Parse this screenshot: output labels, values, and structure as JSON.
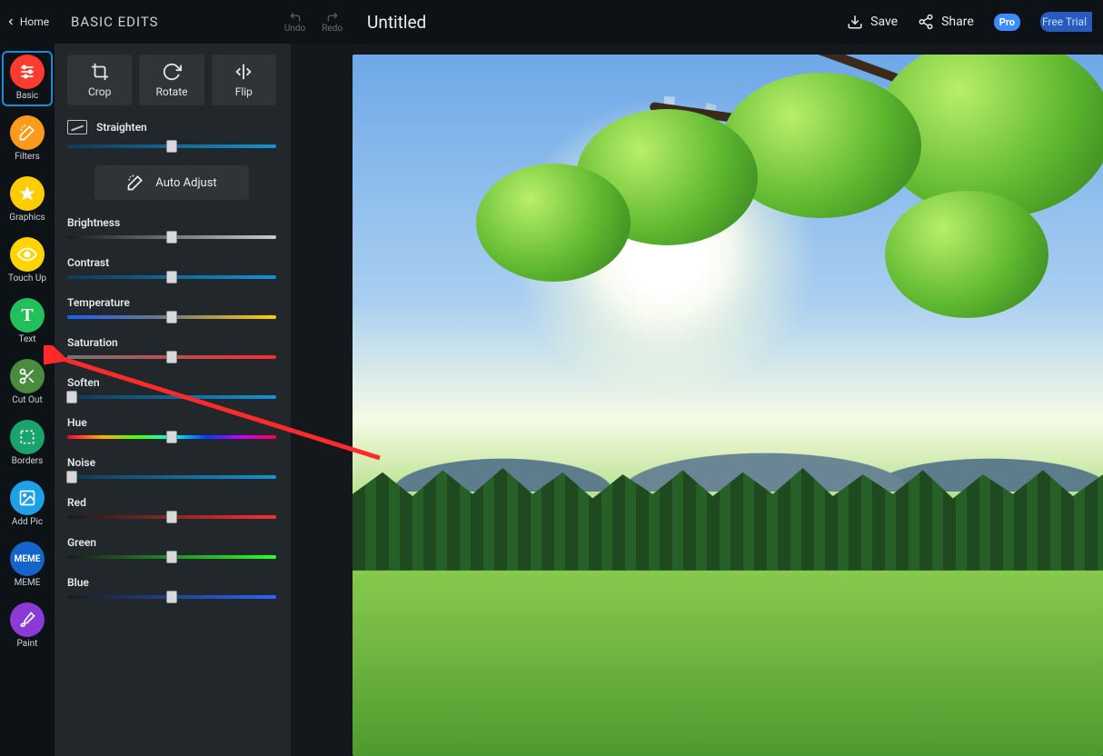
{
  "header": {
    "home_label": "Home",
    "section_title": "BASIC EDITS",
    "undo_label": "Undo",
    "redo_label": "Redo",
    "doc_title": "Untitled",
    "save_label": "Save",
    "share_label": "Share",
    "pro_badge": "Pro",
    "free_trial_label": "Free Trial"
  },
  "tools": {
    "basic": "Basic",
    "filters": "Filters",
    "graphics": "Graphics",
    "touchup": "Touch Up",
    "text": "Text",
    "cutout": "Cut Out",
    "borders": "Borders",
    "addpic": "Add Pic",
    "meme": "MEME",
    "paint": "Paint",
    "meme_icon_text": "MEME"
  },
  "panel": {
    "crop": "Crop",
    "rotate": "Rotate",
    "flip": "Flip",
    "straighten": "Straighten",
    "auto_adjust": "Auto Adjust",
    "brightness": "Brightness",
    "contrast": "Contrast",
    "temperature": "Temperature",
    "saturation": "Saturation",
    "soften": "Soften",
    "hue": "Hue",
    "noise": "Noise",
    "red": "Red",
    "green": "Green",
    "blue": "Blue"
  },
  "slider_values": {
    "straighten": 50,
    "brightness": 50,
    "contrast": 50,
    "temperature": 50,
    "saturation": 50,
    "soften": 2,
    "hue": 50,
    "noise": 2,
    "red": 50,
    "green": 50,
    "blue": 50
  },
  "annotation": {
    "target": "cutout-tool"
  }
}
